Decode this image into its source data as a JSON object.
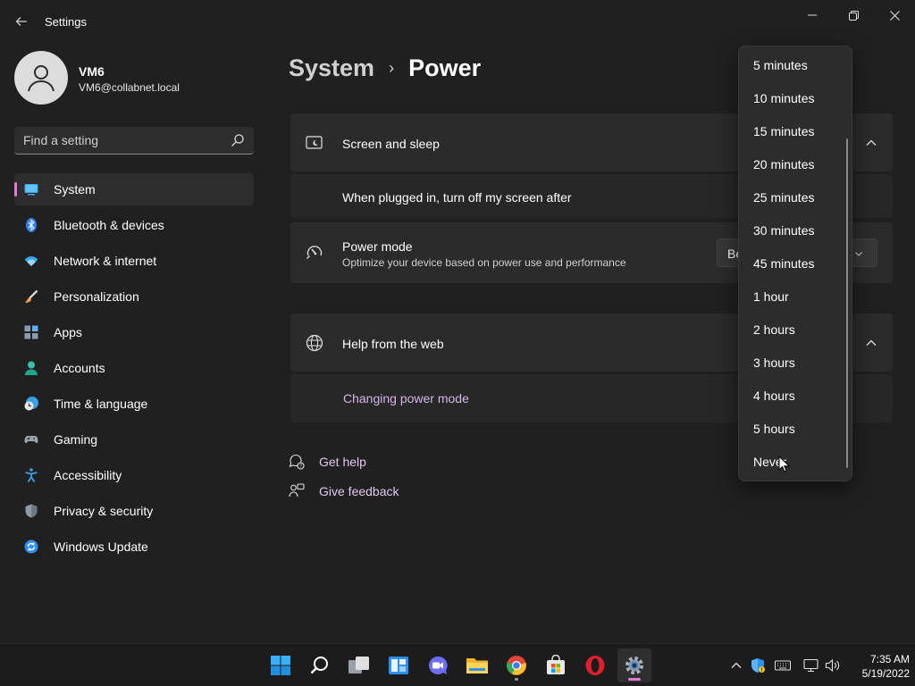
{
  "window": {
    "title": "Settings",
    "back_icon": "back-arrow-icon",
    "controls": [
      "minimize-icon",
      "restore-icon",
      "close-icon"
    ]
  },
  "user": {
    "name": "VM6",
    "email": "VM6@collabnet.local",
    "avatar_icon": "person-icon"
  },
  "search": {
    "placeholder": "Find a setting",
    "icon": "search-icon"
  },
  "sidebar": {
    "accent_color": "#e07ad4",
    "items": [
      {
        "label": "System",
        "icon": "system-icon",
        "active": true
      },
      {
        "label": "Bluetooth & devices",
        "icon": "bluetooth-icon",
        "active": false
      },
      {
        "label": "Network & internet",
        "icon": "wifi-icon",
        "active": false
      },
      {
        "label": "Personalization",
        "icon": "brush-icon",
        "active": false
      },
      {
        "label": "Apps",
        "icon": "apps-icon",
        "active": false
      },
      {
        "label": "Accounts",
        "icon": "accounts-icon",
        "active": false
      },
      {
        "label": "Time & language",
        "icon": "time-language-icon",
        "active": false
      },
      {
        "label": "Gaming",
        "icon": "gamepad-icon",
        "active": false
      },
      {
        "label": "Accessibility",
        "icon": "accessibility-icon",
        "active": false
      },
      {
        "label": "Privacy & security",
        "icon": "shield-icon",
        "active": false
      },
      {
        "label": "Windows Update",
        "icon": "update-icon",
        "active": false
      }
    ]
  },
  "main": {
    "breadcrumb": {
      "parent": "System",
      "current": "Power"
    },
    "screen_sleep": {
      "title": "Screen and sleep",
      "icon": "screen-sleep-icon",
      "row_label": "When plugged in, turn off my screen after"
    },
    "power_mode": {
      "title": "Power mode",
      "description": "Optimize your device based on power use and performance",
      "icon": "power-mode-icon",
      "select_value_partial": "Be"
    },
    "help": {
      "title": "Help from the web",
      "icon": "globe-icon",
      "link": "Changing power mode"
    },
    "get_help": "Get help",
    "give_feedback": "Give feedback"
  },
  "dropdown": {
    "options": [
      "5 minutes",
      "10 minutes",
      "15 minutes",
      "20 minutes",
      "25 minutes",
      "30 minutes",
      "45 minutes",
      "1 hour",
      "2 hours",
      "3 hours",
      "4 hours",
      "5 hours",
      "Never"
    ]
  },
  "taskbar": {
    "apps": [
      "windows-start-icon",
      "search-icon",
      "task-view-icon",
      "widgets-icon",
      "teams-chat-icon",
      "file-explorer-icon",
      "chrome-icon",
      "store-icon",
      "opera-icon",
      "settings-gear-icon"
    ],
    "tray": [
      "chevron-up-icon",
      "security-icon",
      "keyboard-icon",
      "network-icon",
      "volume-icon"
    ],
    "time": "7:35 AM",
    "date": "5/19/2022"
  }
}
